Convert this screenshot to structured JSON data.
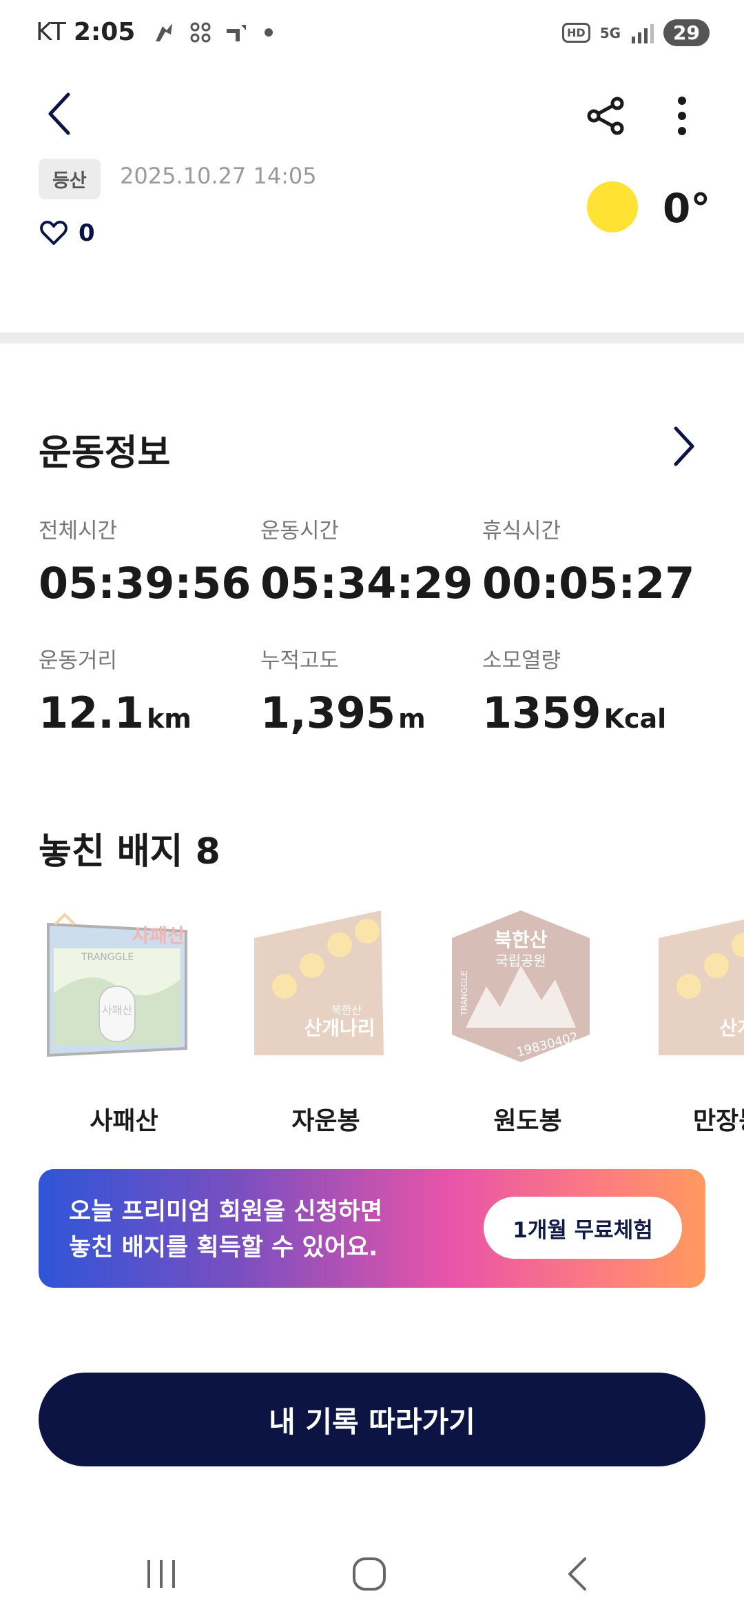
{
  "status_bar": {
    "carrier": "KT",
    "time": "2:05",
    "hd_label": "HD",
    "network_label": "5G",
    "battery": "29"
  },
  "header": {
    "tag": "등산",
    "datetime": "2025.10.27 14:05",
    "likes": "0",
    "temperature": "0°",
    "weather_icon": "sun-icon"
  },
  "exercise": {
    "title": "운동정보",
    "stats": [
      {
        "label": "전체시간",
        "value": "05:39:56",
        "unit": ""
      },
      {
        "label": "운동시간",
        "value": "05:34:29",
        "unit": ""
      },
      {
        "label": "휴식시간",
        "value": "00:05:27",
        "unit": ""
      },
      {
        "label": "운동거리",
        "value": "12.1",
        "unit": "km"
      },
      {
        "label": "누적고도",
        "value": "1,395",
        "unit": "m"
      },
      {
        "label": "소모열량",
        "value": "1359",
        "unit": "Kcal"
      }
    ]
  },
  "badges": {
    "title": "놓친 배지 8",
    "items": [
      {
        "name": "사패산",
        "art_title": "사패산",
        "art_brand": "TRANGGLE",
        "art_stone": "사패산"
      },
      {
        "name": "자운봉",
        "art_small": "북한산",
        "art_title": "산개나리"
      },
      {
        "name": "원도봉",
        "art_title": "북한산",
        "art_sub": "국립공원",
        "art_brand": "TRANGGLE",
        "art_code": "19830402"
      },
      {
        "name": "만장봉",
        "art_title": "산개"
      }
    ]
  },
  "premium": {
    "line1": "오늘 프리미엄 회원을 신청하면",
    "line2": "놓친 배지를 획득할 수 있어요.",
    "button": "1개월 무료체험"
  },
  "follow_button": "내 기록 따라가기",
  "colors": {
    "navy": "#0b1442",
    "sun": "#ffe233",
    "gradient_start": "#2f55d8",
    "gradient_end": "#ff9a5e"
  }
}
